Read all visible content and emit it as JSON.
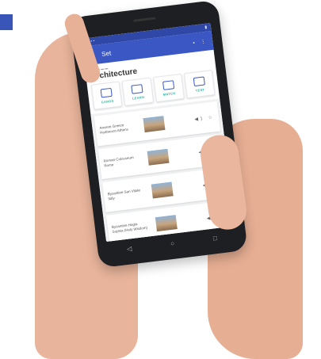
{
  "app_bar": {
    "back_icon": "arrow-left-icon",
    "title": "Set"
  },
  "set_title": "Architecture",
  "modes": [
    {
      "label": "CARDS"
    },
    {
      "label": "LEARN"
    },
    {
      "label": "MATCH"
    },
    {
      "label": "TEST"
    }
  ],
  "terms": [
    {
      "name": "Ancient Greece Parthenon Athens"
    },
    {
      "name": "Roman Colosseum Rome"
    },
    {
      "name": "Byzantine San Vitale Italy"
    },
    {
      "name": "Byzantine Hagia Sophia (Holy Wisdom)"
    }
  ],
  "colors": {
    "app_bar": "#3b57c4",
    "accent": "#2eb5a0",
    "corner_block": "#3a55b8"
  }
}
